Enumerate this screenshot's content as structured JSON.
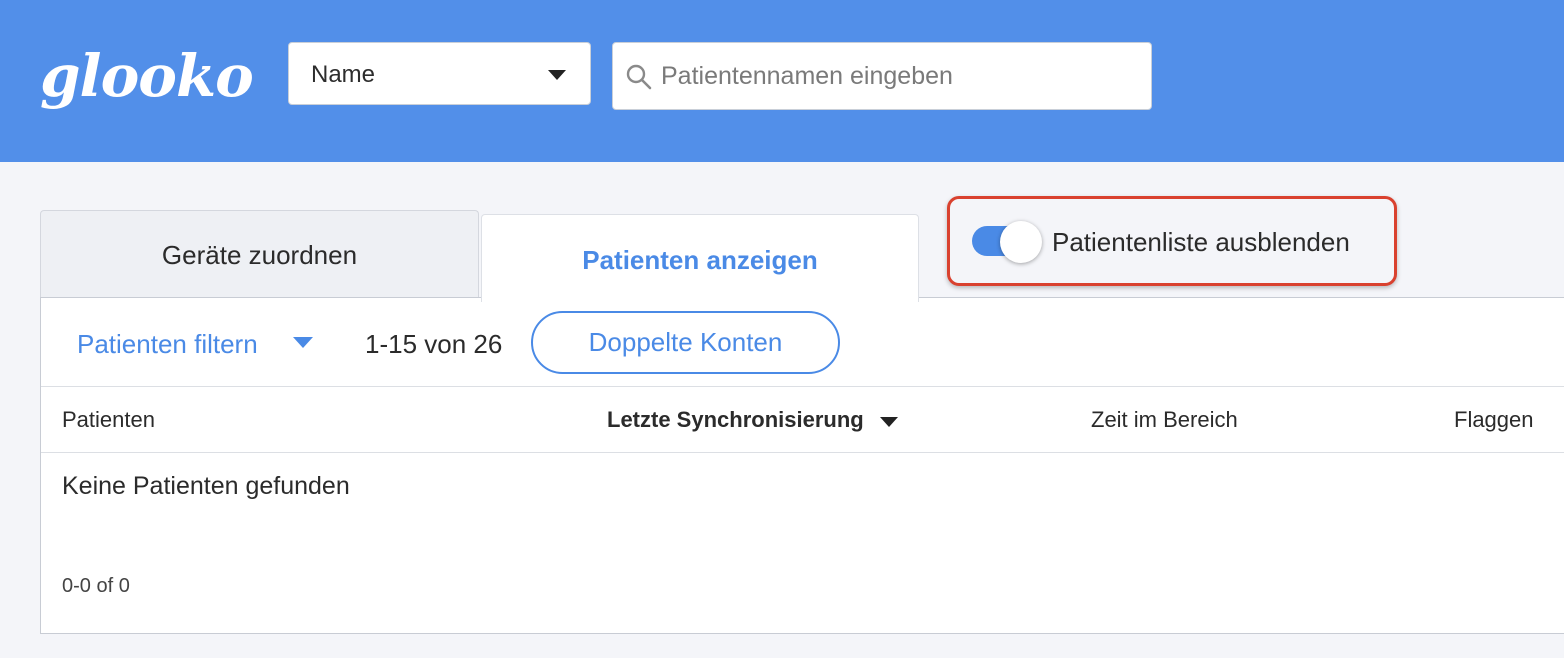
{
  "header": {
    "logo_text": "glooko",
    "brand_color": "#528fe9",
    "search_type": {
      "selected": "Name",
      "icon": "chevron-down-icon"
    },
    "search": {
      "placeholder": "Patientennamen eingeben",
      "value": "",
      "icon": "search-icon"
    }
  },
  "tabs": [
    {
      "label": "Geräte zuordnen",
      "active": false
    },
    {
      "label": "Patienten anzeigen",
      "active": true
    }
  ],
  "toggle": {
    "label": "Patientenliste ausblenden",
    "on": true,
    "accent": "#4a8ae6",
    "highlight_color": "#d9412f"
  },
  "toolbar": {
    "filter_label": "Patienten filtern",
    "range_text": "1-15 von 26",
    "duplicate_button": "Doppelte Konten"
  },
  "table": {
    "columns": [
      {
        "label": "Patienten",
        "sorted": false
      },
      {
        "label": "Letzte Synchronisierung",
        "sorted": true,
        "sort_icon": "caret-down-icon"
      },
      {
        "label": "Zeit im Bereich",
        "sorted": false
      },
      {
        "label": "Flaggen",
        "sorted": false
      }
    ],
    "rows": [],
    "empty_message": "Keine Patienten gefunden",
    "pagination": "0-0 of 0"
  }
}
